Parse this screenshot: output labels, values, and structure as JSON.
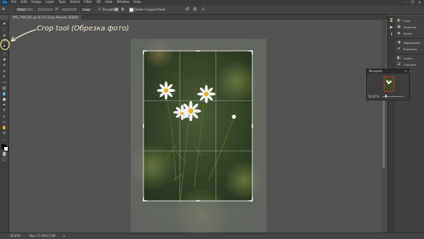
{
  "app": {
    "logo_text": "Ps"
  },
  "menu": [
    "File",
    "Edit",
    "Image",
    "Layer",
    "Type",
    "Select",
    "Filter",
    "3D",
    "View",
    "Window",
    "Help"
  ],
  "window_controls": [
    "–",
    "❐",
    "✕"
  ],
  "options_bar": {
    "ratio_value": "Ratio",
    "clear_label": "Clear",
    "straighten_label": "Straighten",
    "delete_cropped_label": "Delete Cropped Pixels"
  },
  "document_tab": {
    "title": "IMG_7985.JPG @ 16.7% (Crop Preview, RGB/8)"
  },
  "annotation": {
    "text": "Crop tool (Обрезка фото)"
  },
  "right_panels": {
    "items": [
      {
        "label": "Color",
        "icon": "color-icon"
      },
      {
        "label": "Swatches",
        "icon": "swatches-icon"
      },
      {
        "label": "Styles",
        "icon": "styles-icon"
      },
      {
        "label": "Adjustments",
        "icon": "adjustments-icon"
      },
      {
        "label": "Properties",
        "icon": "properties-icon"
      },
      {
        "label": "Layers",
        "icon": "layers-icon"
      },
      {
        "label": "Channels",
        "icon": "channels-icon"
      },
      {
        "label": "Paths",
        "icon": "paths-icon"
      }
    ]
  },
  "navigator": {
    "title": "Navigator",
    "zoom": "16.67%"
  },
  "status_bar": {
    "zoom": "16.67%",
    "doc_info": "Doc: 17.2M/17.2M"
  },
  "colors": {
    "workspace": "#535353",
    "crop_border": "#ffffff",
    "annotation_text": "#f2ead2",
    "annotation_circle": "#d9c98a",
    "foreground_swatch": "#000000",
    "background_swatch": "#ffffff"
  }
}
